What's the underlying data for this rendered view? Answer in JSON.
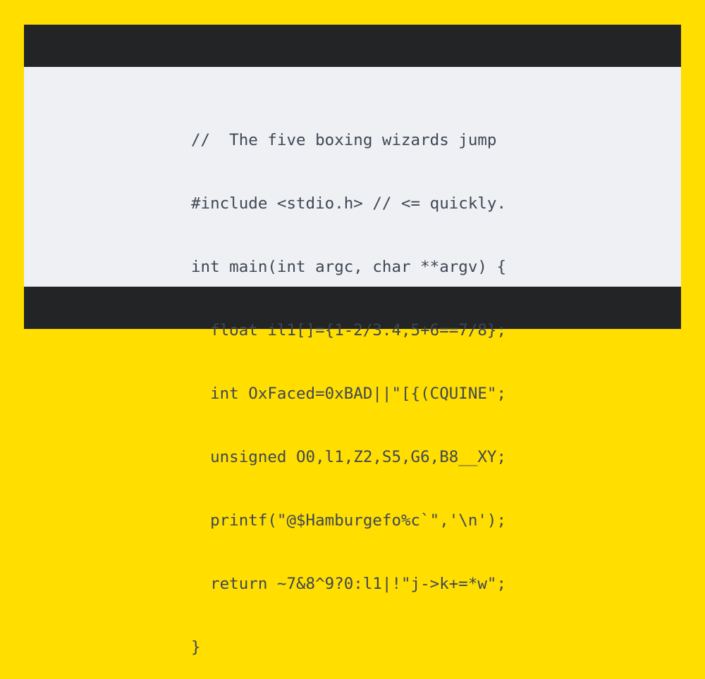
{
  "code": {
    "lines": [
      "//  The five boxing wizards jump",
      "#include <stdio.h> // <= quickly.",
      "int main(int argc, char **argv) {",
      "  float il1[]={1-2/3.4,5+6==7/8};",
      "  int OxFaced=0xBAD||\"[{(CQUINE\";",
      "  unsigned O0,l1,Z2,S5,G6,B8__XY;",
      "  printf(\"@$Hamburgefo%c`\",'\\n');",
      "  return ~7&8^9?0:l1|!\"j->k+=*w\";",
      "}"
    ]
  },
  "colors": {
    "background": "#FFDE00",
    "frame": "#222426",
    "code_background": "#EFF0F4",
    "code_text": "#3E4754"
  }
}
